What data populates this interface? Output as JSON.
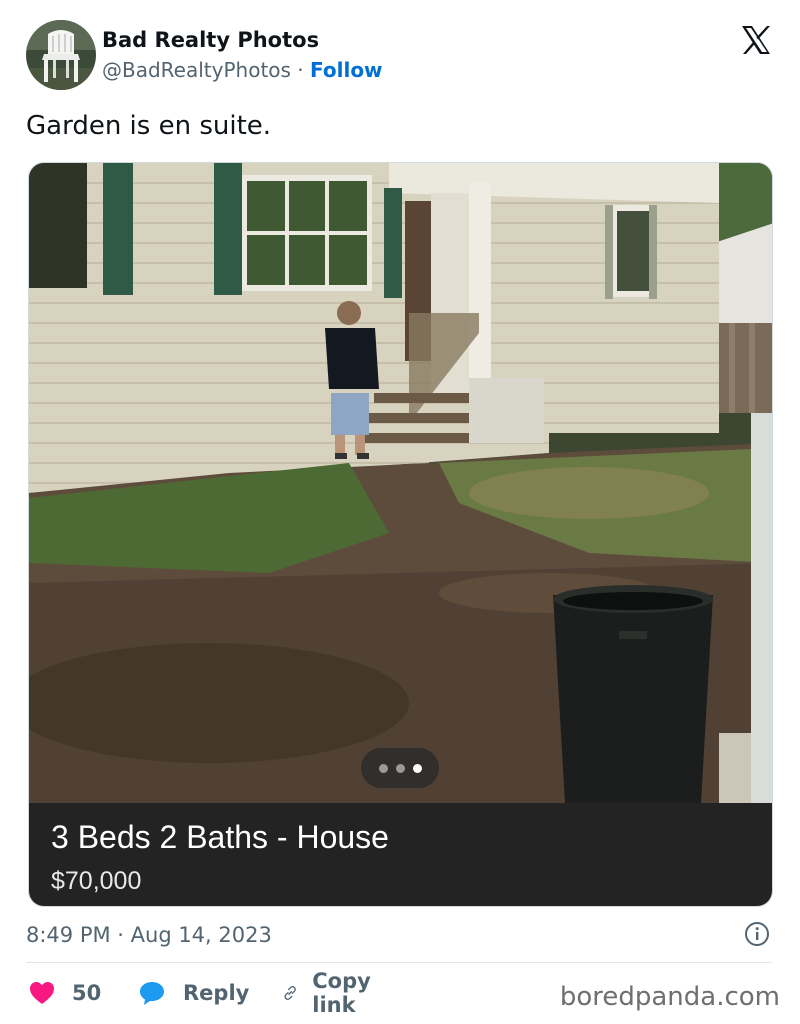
{
  "author": {
    "display_name": "Bad Realty Photos",
    "handle": "@BadRealtyPhotos",
    "separator": "·",
    "follow_label": "Follow",
    "avatar_icon": "white-plastic-chair"
  },
  "platform_icon": "x-logo-icon",
  "tweet": {
    "text": "Garden is en suite."
  },
  "media": {
    "listing_title": "3 Beds 2 Baths - House",
    "listing_price": "$70,000",
    "carousel_dots": 3,
    "active_dot": 3
  },
  "meta": {
    "timestamp": "8:49 PM · Aug 14, 2023"
  },
  "actions": {
    "like_count": "50",
    "reply_label": "Reply",
    "copy_label": "Copy link"
  },
  "watermark": "boredpanda.com",
  "colors": {
    "link_blue": "#006fd6",
    "like_pink": "#f91880",
    "reply_blue": "#1d9bf0",
    "text_gray": "#536471",
    "listing_bg": "#232323"
  }
}
